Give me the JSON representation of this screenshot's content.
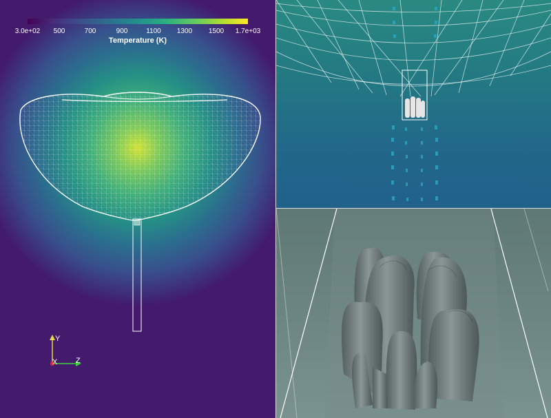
{
  "colorbar": {
    "title": "Temperature (K)",
    "ticks": [
      "3.0e+02",
      "500",
      "700",
      "900",
      "1100",
      "1300",
      "1500",
      "1.7e+03"
    ],
    "colormap": "viridis"
  },
  "axes_triad": {
    "y": "Y",
    "x": "X",
    "z": "Z"
  },
  "colors": {
    "wireframe": "#ffffff",
    "panel_divider": "#dddddd",
    "crystal_surface": "#6f7b7b"
  }
}
